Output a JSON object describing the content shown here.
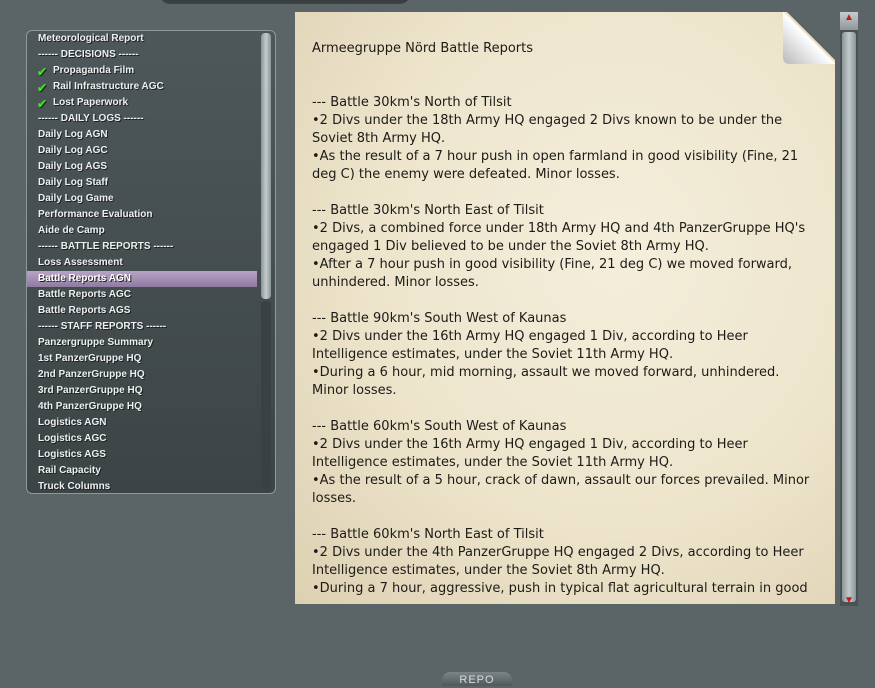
{
  "left_menu": {
    "items": [
      {
        "label": "Meteorological Report"
      },
      {
        "label": "------ DECISIONS ------"
      },
      {
        "label": "Propaganda Film",
        "checked": true
      },
      {
        "label": "Rail Infrastructure AGC",
        "checked": true
      },
      {
        "label": "Lost Paperwork",
        "checked": true
      },
      {
        "label": "------ DAILY LOGS ------"
      },
      {
        "label": "Daily Log AGN"
      },
      {
        "label": "Daily Log AGC"
      },
      {
        "label": "Daily Log AGS"
      },
      {
        "label": "Daily Log Staff"
      },
      {
        "label": "Daily Log Game"
      },
      {
        "label": "Performance Evaluation"
      },
      {
        "label": "Aide de Camp"
      },
      {
        "label": "------ BATTLE REPORTS ------"
      },
      {
        "label": "Loss Assessment"
      },
      {
        "label": "Battle Reports AGN",
        "selected": true
      },
      {
        "label": "Battle Reports AGC"
      },
      {
        "label": "Battle Reports AGS"
      },
      {
        "label": "------ STAFF REPORTS ------"
      },
      {
        "label": "Panzergruppe Summary"
      },
      {
        "label": "1st PanzerGruppe HQ"
      },
      {
        "label": "2nd PanzerGruppe HQ"
      },
      {
        "label": "3rd PanzerGruppe HQ"
      },
      {
        "label": "4th PanzerGruppe HQ"
      },
      {
        "label": "Logistics AGN"
      },
      {
        "label": "Logistics AGC"
      },
      {
        "label": "Logistics AGS"
      },
      {
        "label": "Rail Capacity"
      },
      {
        "label": "Truck Columns"
      }
    ]
  },
  "report": {
    "title": "Armeegruppe Nörd Battle Reports",
    "battles": [
      {
        "lines": [
          "--- Battle 30km's North  of Tilsit",
          "•2 Divs under the 18th Army HQ engaged 2 Divs known to be under the Soviet 8th Army HQ.",
          "•As the result of a 7 hour push in open farmland in good visibility (Fine, 21 deg C) the enemy were defeated. Minor losses."
        ]
      },
      {
        "lines": [
          "--- Battle 30km's North East of Tilsit",
          "•2 Divs, a combined force under 18th Army HQ and 4th PanzerGruppe HQ's engaged 1 Div believed to be under the Soviet 8th Army HQ.",
          "•After a 7 hour push in good visibility (Fine, 21 deg C) we moved forward, unhindered. Minor losses."
        ]
      },
      {
        "lines": [
          "--- Battle 90km's South West of Kaunas",
          "•2 Divs under the 16th Army HQ engaged 1 Div, according to Heer Intelligence estimates, under the Soviet 11th Army HQ.",
          "•During a 6 hour, mid morning,  assault we moved forward, unhindered. Minor losses."
        ]
      },
      {
        "lines": [
          "--- Battle 60km's South West of Kaunas",
          "•2 Divs under the 16th Army HQ engaged 1 Div, according to Heer Intelligence estimates, under the Soviet 11th Army HQ.",
          "•As the result of a 5 hour, crack of dawn,  assault our forces prevailed. Minor losses."
        ]
      },
      {
        "lines": [
          "--- Battle 60km's North East of Tilsit",
          "•2 Divs under the 4th PanzerGruppe HQ engaged 2 Divs, according to Heer Intelligence estimates, under the Soviet 8th Army HQ.",
          "•During a 7 hour, aggressive,  push in typical flat agricultural terrain in good"
        ]
      }
    ]
  },
  "footer": {
    "tab_label": "REPO"
  },
  "colors": {
    "background": "#5b6466",
    "paper": "#ede4cb",
    "selected": "#a08db3",
    "check": "#3cdc2a",
    "scroll_arrow": "#c21a1a"
  },
  "icons": {
    "check": "check-icon",
    "scroll_up": "scroll-up-arrow-icon",
    "scroll_down": "scroll-down-arrow-icon",
    "page_curl": "page-curl-icon"
  }
}
